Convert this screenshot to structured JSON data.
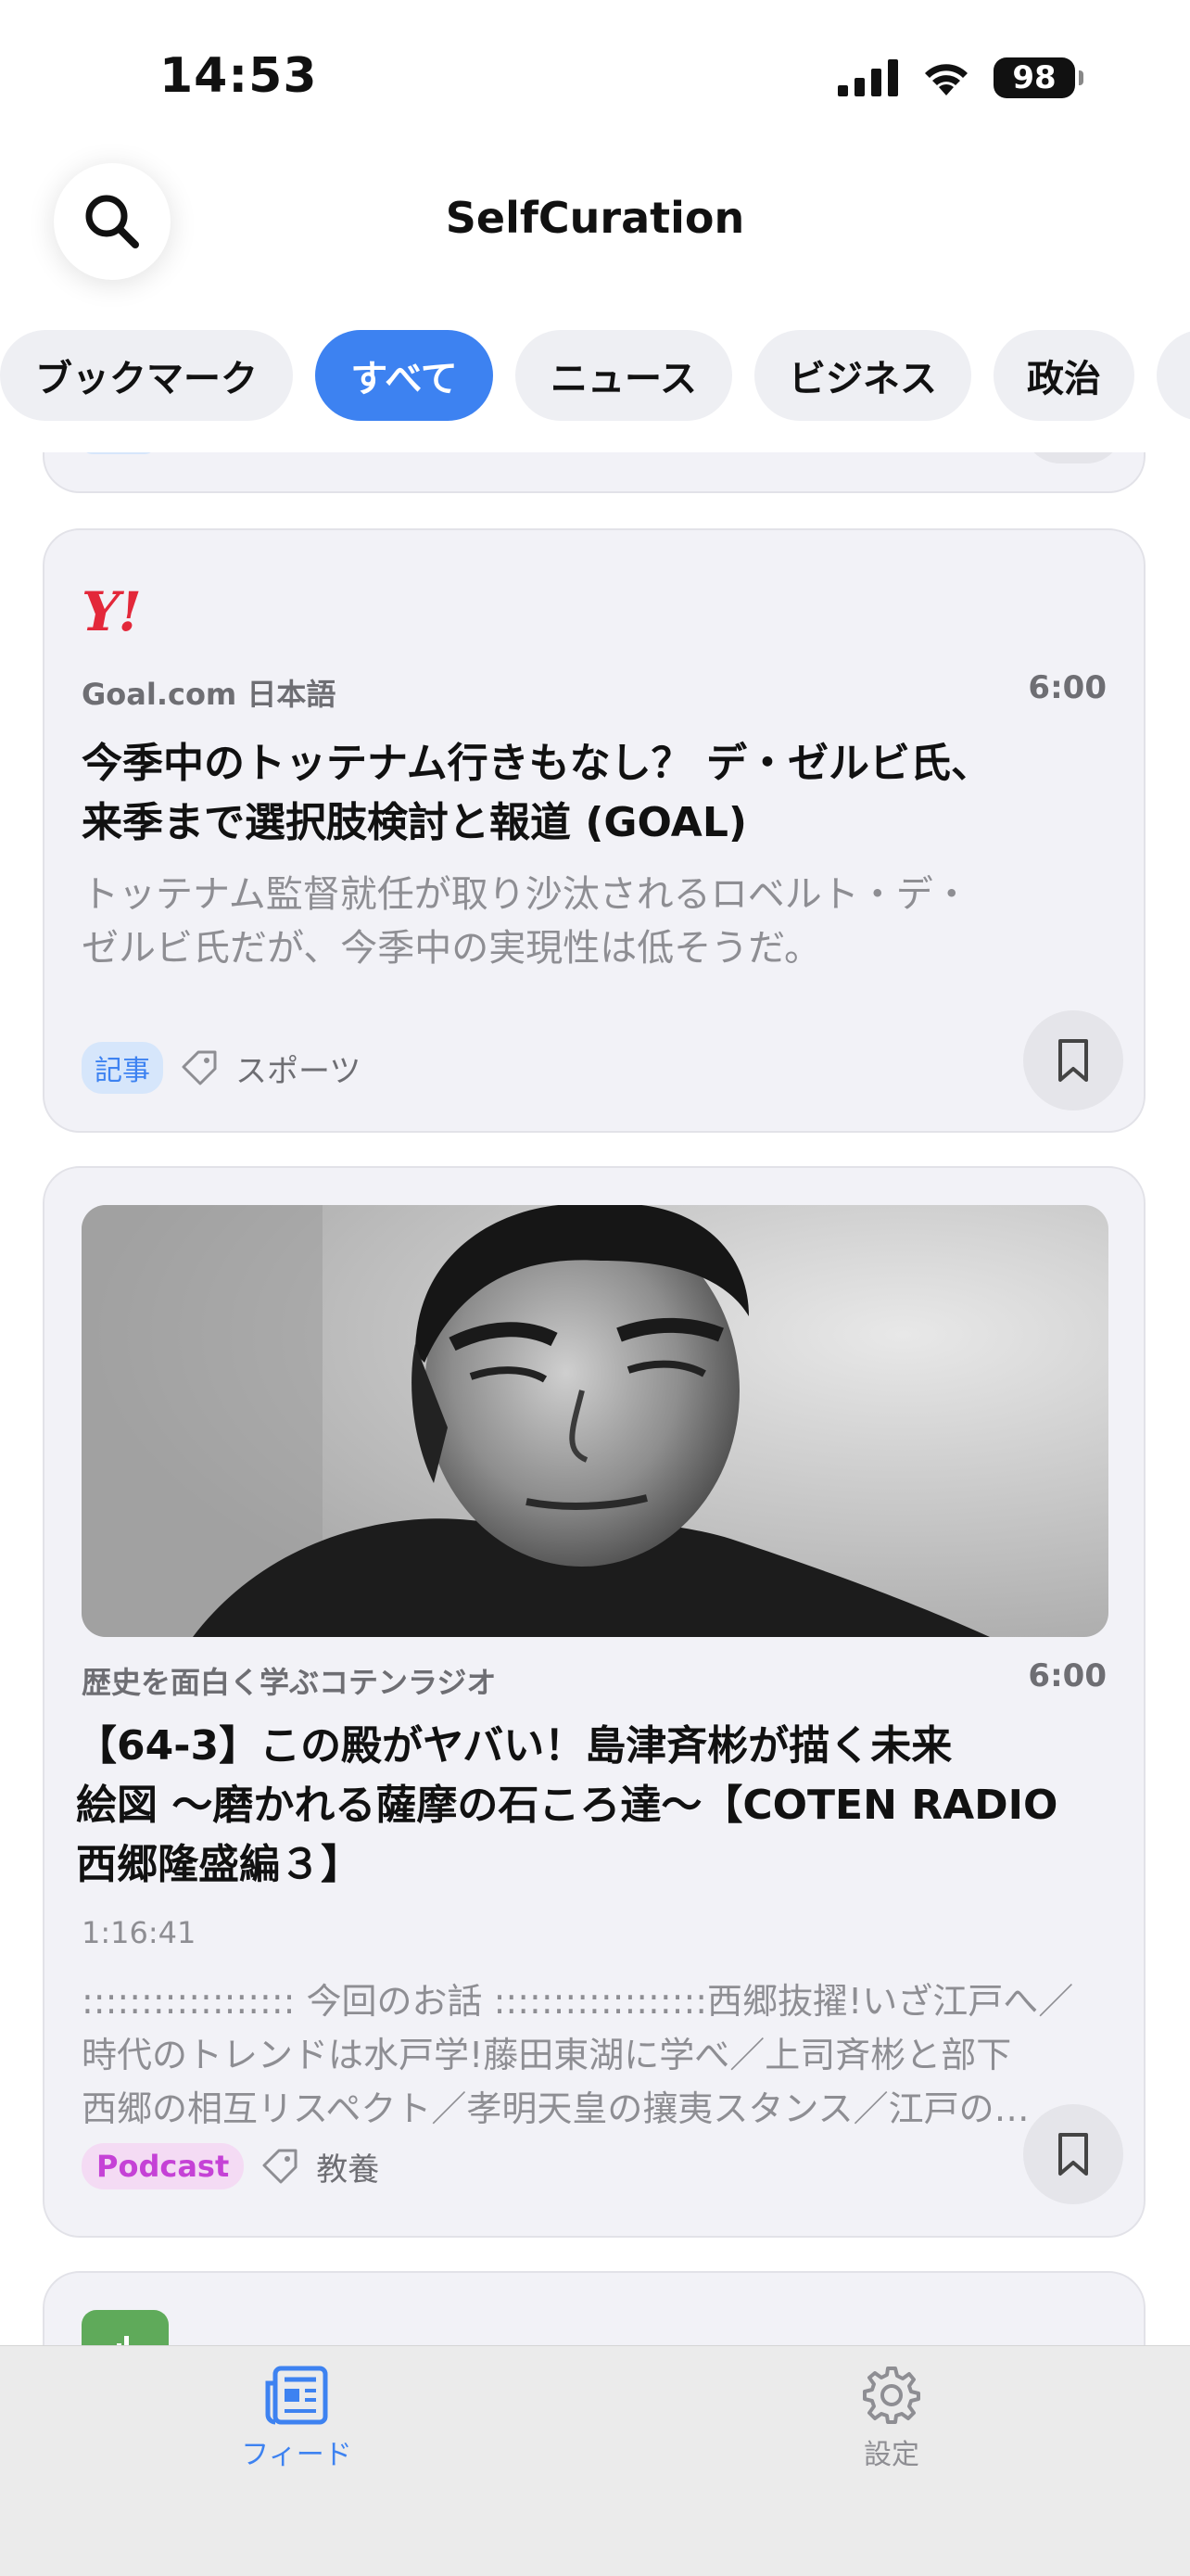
{
  "status": {
    "time": "14:53",
    "battery": "98"
  },
  "header": {
    "title": "SelfCuration",
    "search_icon": "magnifying-glass"
  },
  "categories": [
    {
      "label": "ブックマーク",
      "active": false
    },
    {
      "label": "すべて",
      "active": true
    },
    {
      "label": "ニュース",
      "active": false
    },
    {
      "label": "ビジネス",
      "active": false
    },
    {
      "label": "政治",
      "active": false
    }
  ],
  "feed": {
    "articles": [
      {
        "logo": "Y!",
        "source": "Goal.com 日本語",
        "time": "6:00",
        "title_line1": "今季中のトッテナム行きもなし？ デ・ゼルビ氏、",
        "title_line2": "来季まで選択肢検討と報道 (GOAL)",
        "desc_line1": "トッテナム監督就任が取り沙汰されるロベルト・デ・",
        "desc_line2": "ゼルビ氏だが、今季中の実現性は低そうだ。",
        "type_badge": "記事",
        "tag": "スポーツ"
      },
      {
        "source": "歴史を面白く学ぶコテンラジオ",
        "time": "6:00",
        "title_line1": "【64-3】この殿がヤバい！島津斉彬が描く未来",
        "title_line2": "絵図 〜磨かれる薩摩の石ころ達〜【COTEN RADIO",
        "title_line3": "西郷隆盛編３】",
        "duration": "1:16:41",
        "desc_line1": ":::::::::::::::::: 今回のお話 ::::::::::::::::::西郷抜擢!いざ江戸へ／",
        "desc_line2": "時代のトレンドは水戸学!藤田東湖に学べ／上司斉彬と部下",
        "desc_line3": "西郷の相互リスペクト／孝明天皇の攘夷スタンス／江戸の…",
        "type_badge": "Podcast",
        "tag": "教養"
      }
    ]
  },
  "tabbar": {
    "feed_label": "フィード",
    "settings_label": "設定"
  },
  "colors": {
    "accent": "#3d82f1",
    "podcast": "#c542d6"
  }
}
